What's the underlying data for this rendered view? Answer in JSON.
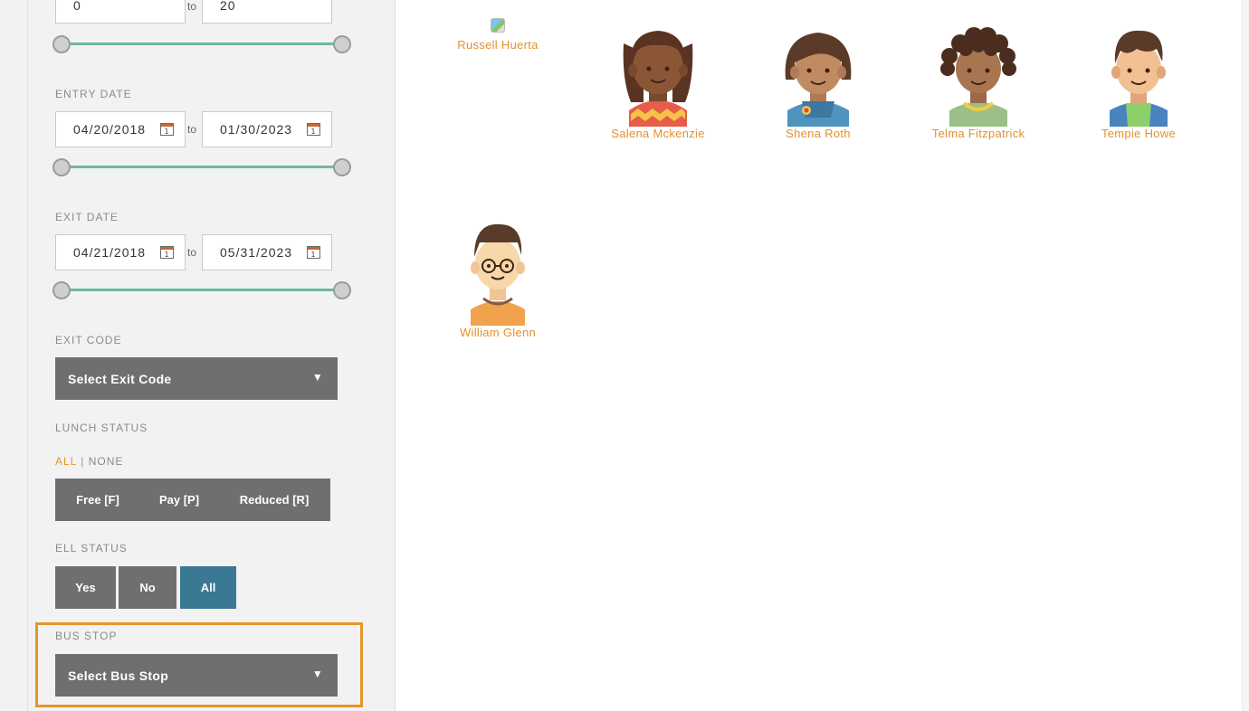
{
  "filters": {
    "age_range": {
      "from": "0",
      "to_word": "to",
      "to": "20"
    },
    "entry_date": {
      "label": "ENTRY DATE",
      "from": "04/20/2018",
      "to_word": "to",
      "to": "01/30/2023",
      "calendar_day": "1"
    },
    "exit_date": {
      "label": "EXIT DATE",
      "from": "04/21/2018",
      "to_word": "to",
      "to": "05/31/2023",
      "calendar_day": "1"
    },
    "exit_code": {
      "label": "EXIT CODE",
      "placeholder": "Select Exit Code",
      "caret": "▼"
    },
    "lunch_status": {
      "label": "LUNCH STATUS",
      "all": "ALL",
      "separator": "|",
      "none": "NONE",
      "options": [
        "Free [F]",
        "Pay [P]",
        "Reduced [R]"
      ]
    },
    "ell_status": {
      "label": "ELL STATUS",
      "options": [
        "Yes",
        "No",
        "All"
      ],
      "selected": "All"
    },
    "bus_stop": {
      "label": "BUS STOP",
      "placeholder": "Select Bus Stop",
      "caret": "▼"
    }
  },
  "students": [
    {
      "name": "Russell Huerta",
      "icon": "broken-image-icon"
    },
    {
      "name": "Salena Mckenzie",
      "icon": "girl-pigtails-avatar"
    },
    {
      "name": "Shena Roth",
      "icon": "girl-bob-avatar"
    },
    {
      "name": "Telma Fitzpatrick",
      "icon": "girl-curly-avatar"
    },
    {
      "name": "Tempie Howe",
      "icon": "boy-avatar"
    },
    {
      "name": "William Glenn",
      "icon": "boy-glasses-avatar"
    }
  ],
  "colors": {
    "accent_orange": "#e5962b",
    "slider_teal": "#6cb8a2",
    "button_gray": "#6f6f6f",
    "active_blue": "#3a7893"
  }
}
